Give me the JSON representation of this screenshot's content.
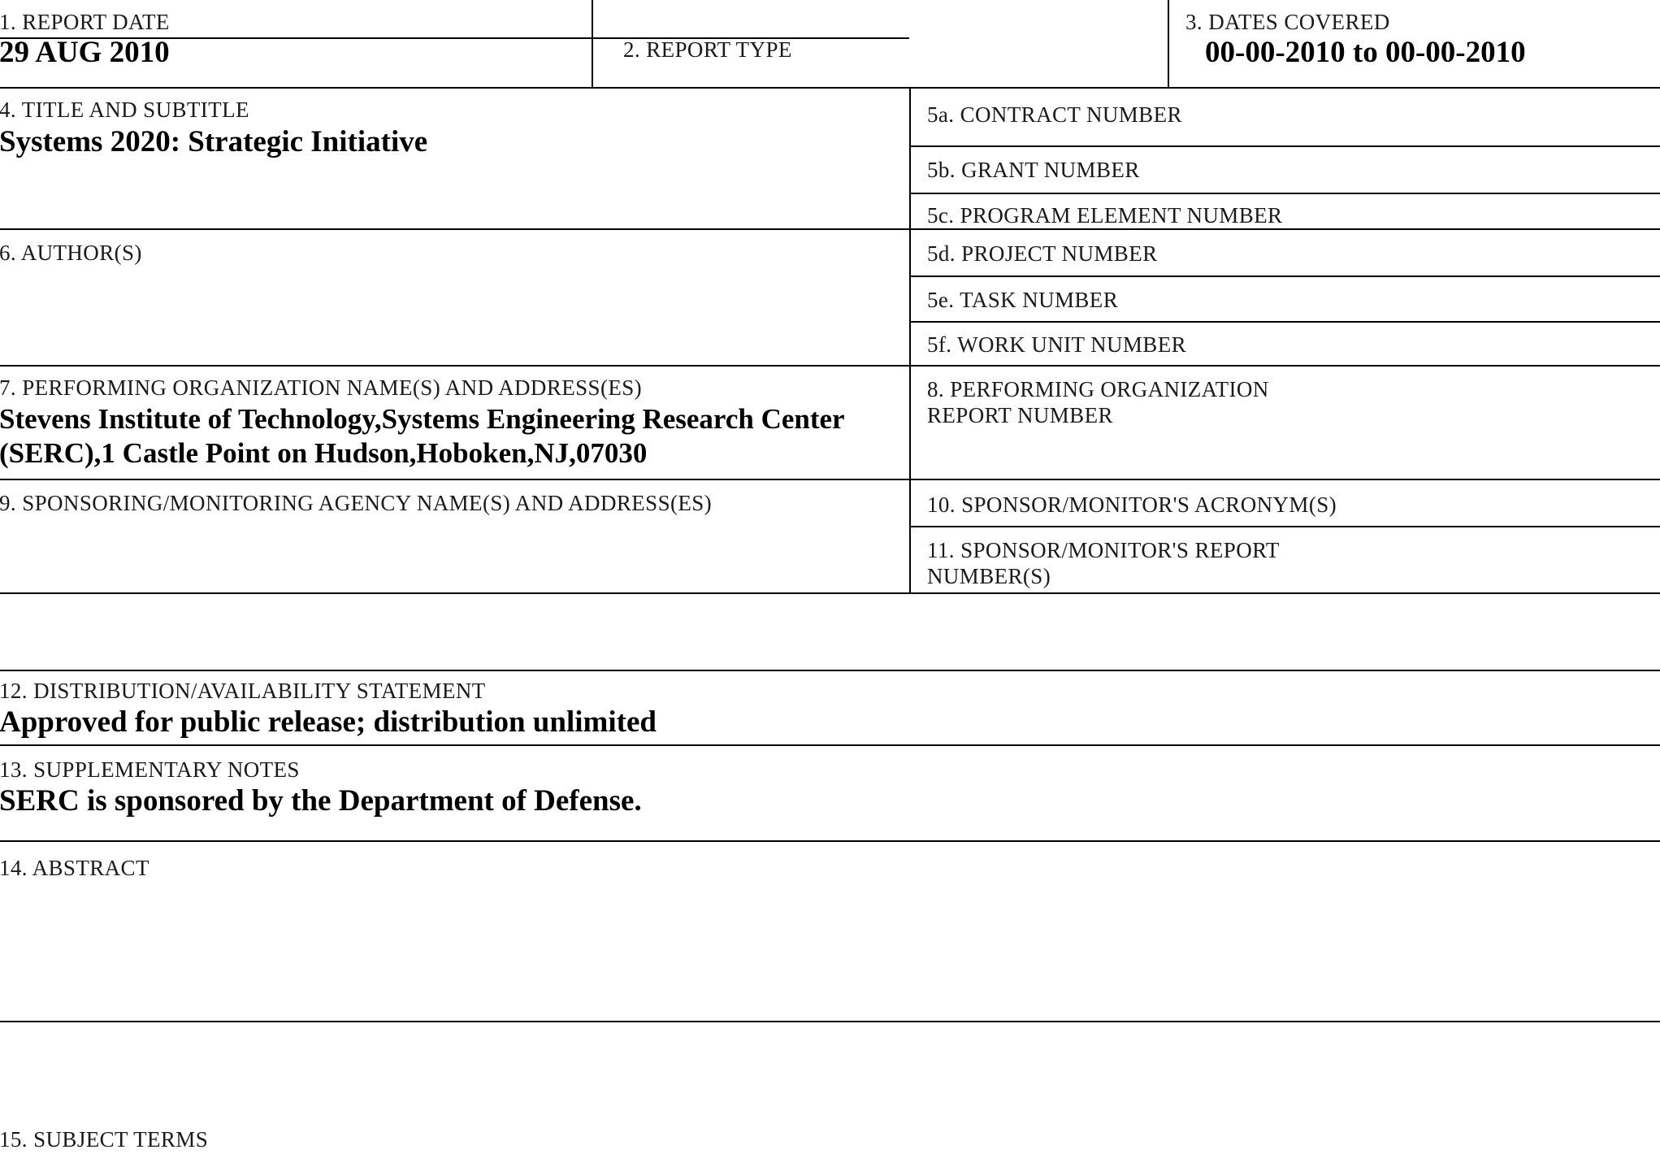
{
  "document": {
    "form_name": "Report Documentation Page (SF 298)"
  },
  "fields": {
    "report_date": {
      "number": "1.",
      "label": "1. REPORT DATE",
      "value": "29 AUG 2010"
    },
    "report_type": {
      "label": "2. REPORT TYPE",
      "value": ""
    },
    "dates_covered": {
      "label": "3. DATES COVERED",
      "value": "00-00-2010 to 00-00-2010"
    },
    "title_and_subtitle": {
      "label": "4. TITLE AND SUBTITLE",
      "value": "Systems 2020: Strategic Initiative"
    },
    "contract_number": {
      "label": "5a. CONTRACT NUMBER",
      "value": ""
    },
    "grant_number": {
      "label": "5b. GRANT NUMBER",
      "value": ""
    },
    "program_element_number": {
      "label": "5c. PROGRAM ELEMENT NUMBER",
      "value": ""
    },
    "authors": {
      "label": "6. AUTHOR(S)",
      "value": ""
    },
    "project_number": {
      "label": "5d. PROJECT NUMBER",
      "value": ""
    },
    "task_number": {
      "label": "5e. TASK NUMBER",
      "value": ""
    },
    "work_unit_number": {
      "label": "5f. WORK UNIT NUMBER",
      "value": ""
    },
    "performing_organization": {
      "label": "7. PERFORMING ORGANIZATION NAME(S) AND ADDRESS(ES)",
      "value_line1": "Stevens Institute of Technology,Systems Engineering Research Center",
      "value_line2": "(SERC),1 Castle Point on Hudson,Hoboken,NJ,07030"
    },
    "performing_org_report_number": {
      "label_line1": "8. PERFORMING ORGANIZATION",
      "label_line2": "REPORT NUMBER",
      "value": ""
    },
    "sponsoring_agency": {
      "label": "9. SPONSORING/MONITORING AGENCY NAME(S) AND ADDRESS(ES)",
      "value": ""
    },
    "sponsor_acronym": {
      "label": "10. SPONSOR/MONITOR'S ACRONYM(S)",
      "value": ""
    },
    "sponsor_report_number": {
      "label_line1": "11. SPONSOR/MONITOR'S REPORT",
      "label_line2": "NUMBER(S)",
      "value": ""
    },
    "distribution_statement": {
      "label": "12. DISTRIBUTION/AVAILABILITY STATEMENT",
      "value": "Approved for public release; distribution unlimited"
    },
    "supplementary_notes": {
      "label": "13. SUPPLEMENTARY NOTES",
      "value": "SERC is sponsored by the Department of Defense."
    },
    "abstract": {
      "label": "14. ABSTRACT",
      "value": ""
    },
    "subject_terms": {
      "label": "15. SUBJECT TERMS",
      "value": ""
    }
  },
  "colors": {
    "rule": "#000000",
    "label_text": "#1a1a1a",
    "value_text": "#000000",
    "background": "#ffffff"
  }
}
